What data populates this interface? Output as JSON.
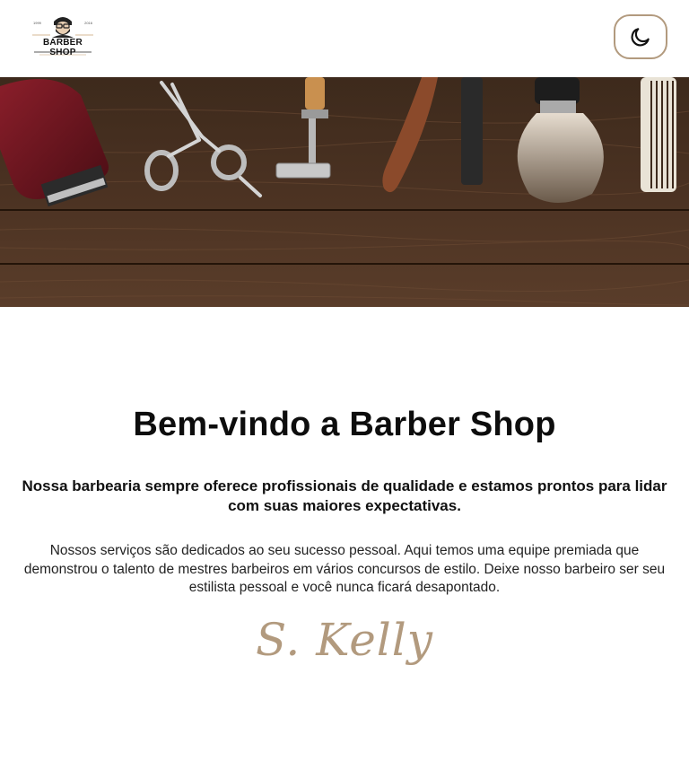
{
  "header": {
    "logo": {
      "text": "BARBER SHOP",
      "year_left": "1999",
      "year_right": "2016",
      "icon": "barber-face-icon"
    },
    "theme_toggle": {
      "icon": "moon-icon",
      "accent_color": "#b29a7e"
    }
  },
  "hero": {
    "image": "barber-tools-on-wood"
  },
  "main": {
    "title": "Bem-vindo a Barber Shop",
    "subtitle": "Nossa barbearia sempre oferece profissionais de qualidade e estamos prontos para lidar com suas maiores expectativas.",
    "body": "Nossos serviços são dedicados ao seu sucesso pessoal. Aqui temos uma equipe premiada que demonstrou o talento de mestres barbeiros em vários concursos de estilo. Deixe nosso barbeiro ser seu estilista pessoal e você nunca ficará desapontado.",
    "signature": "S. Kelly"
  },
  "colors": {
    "accent": "#b29a7e",
    "wood_dark": "#3a2618",
    "wood_light": "#6b4a33"
  }
}
